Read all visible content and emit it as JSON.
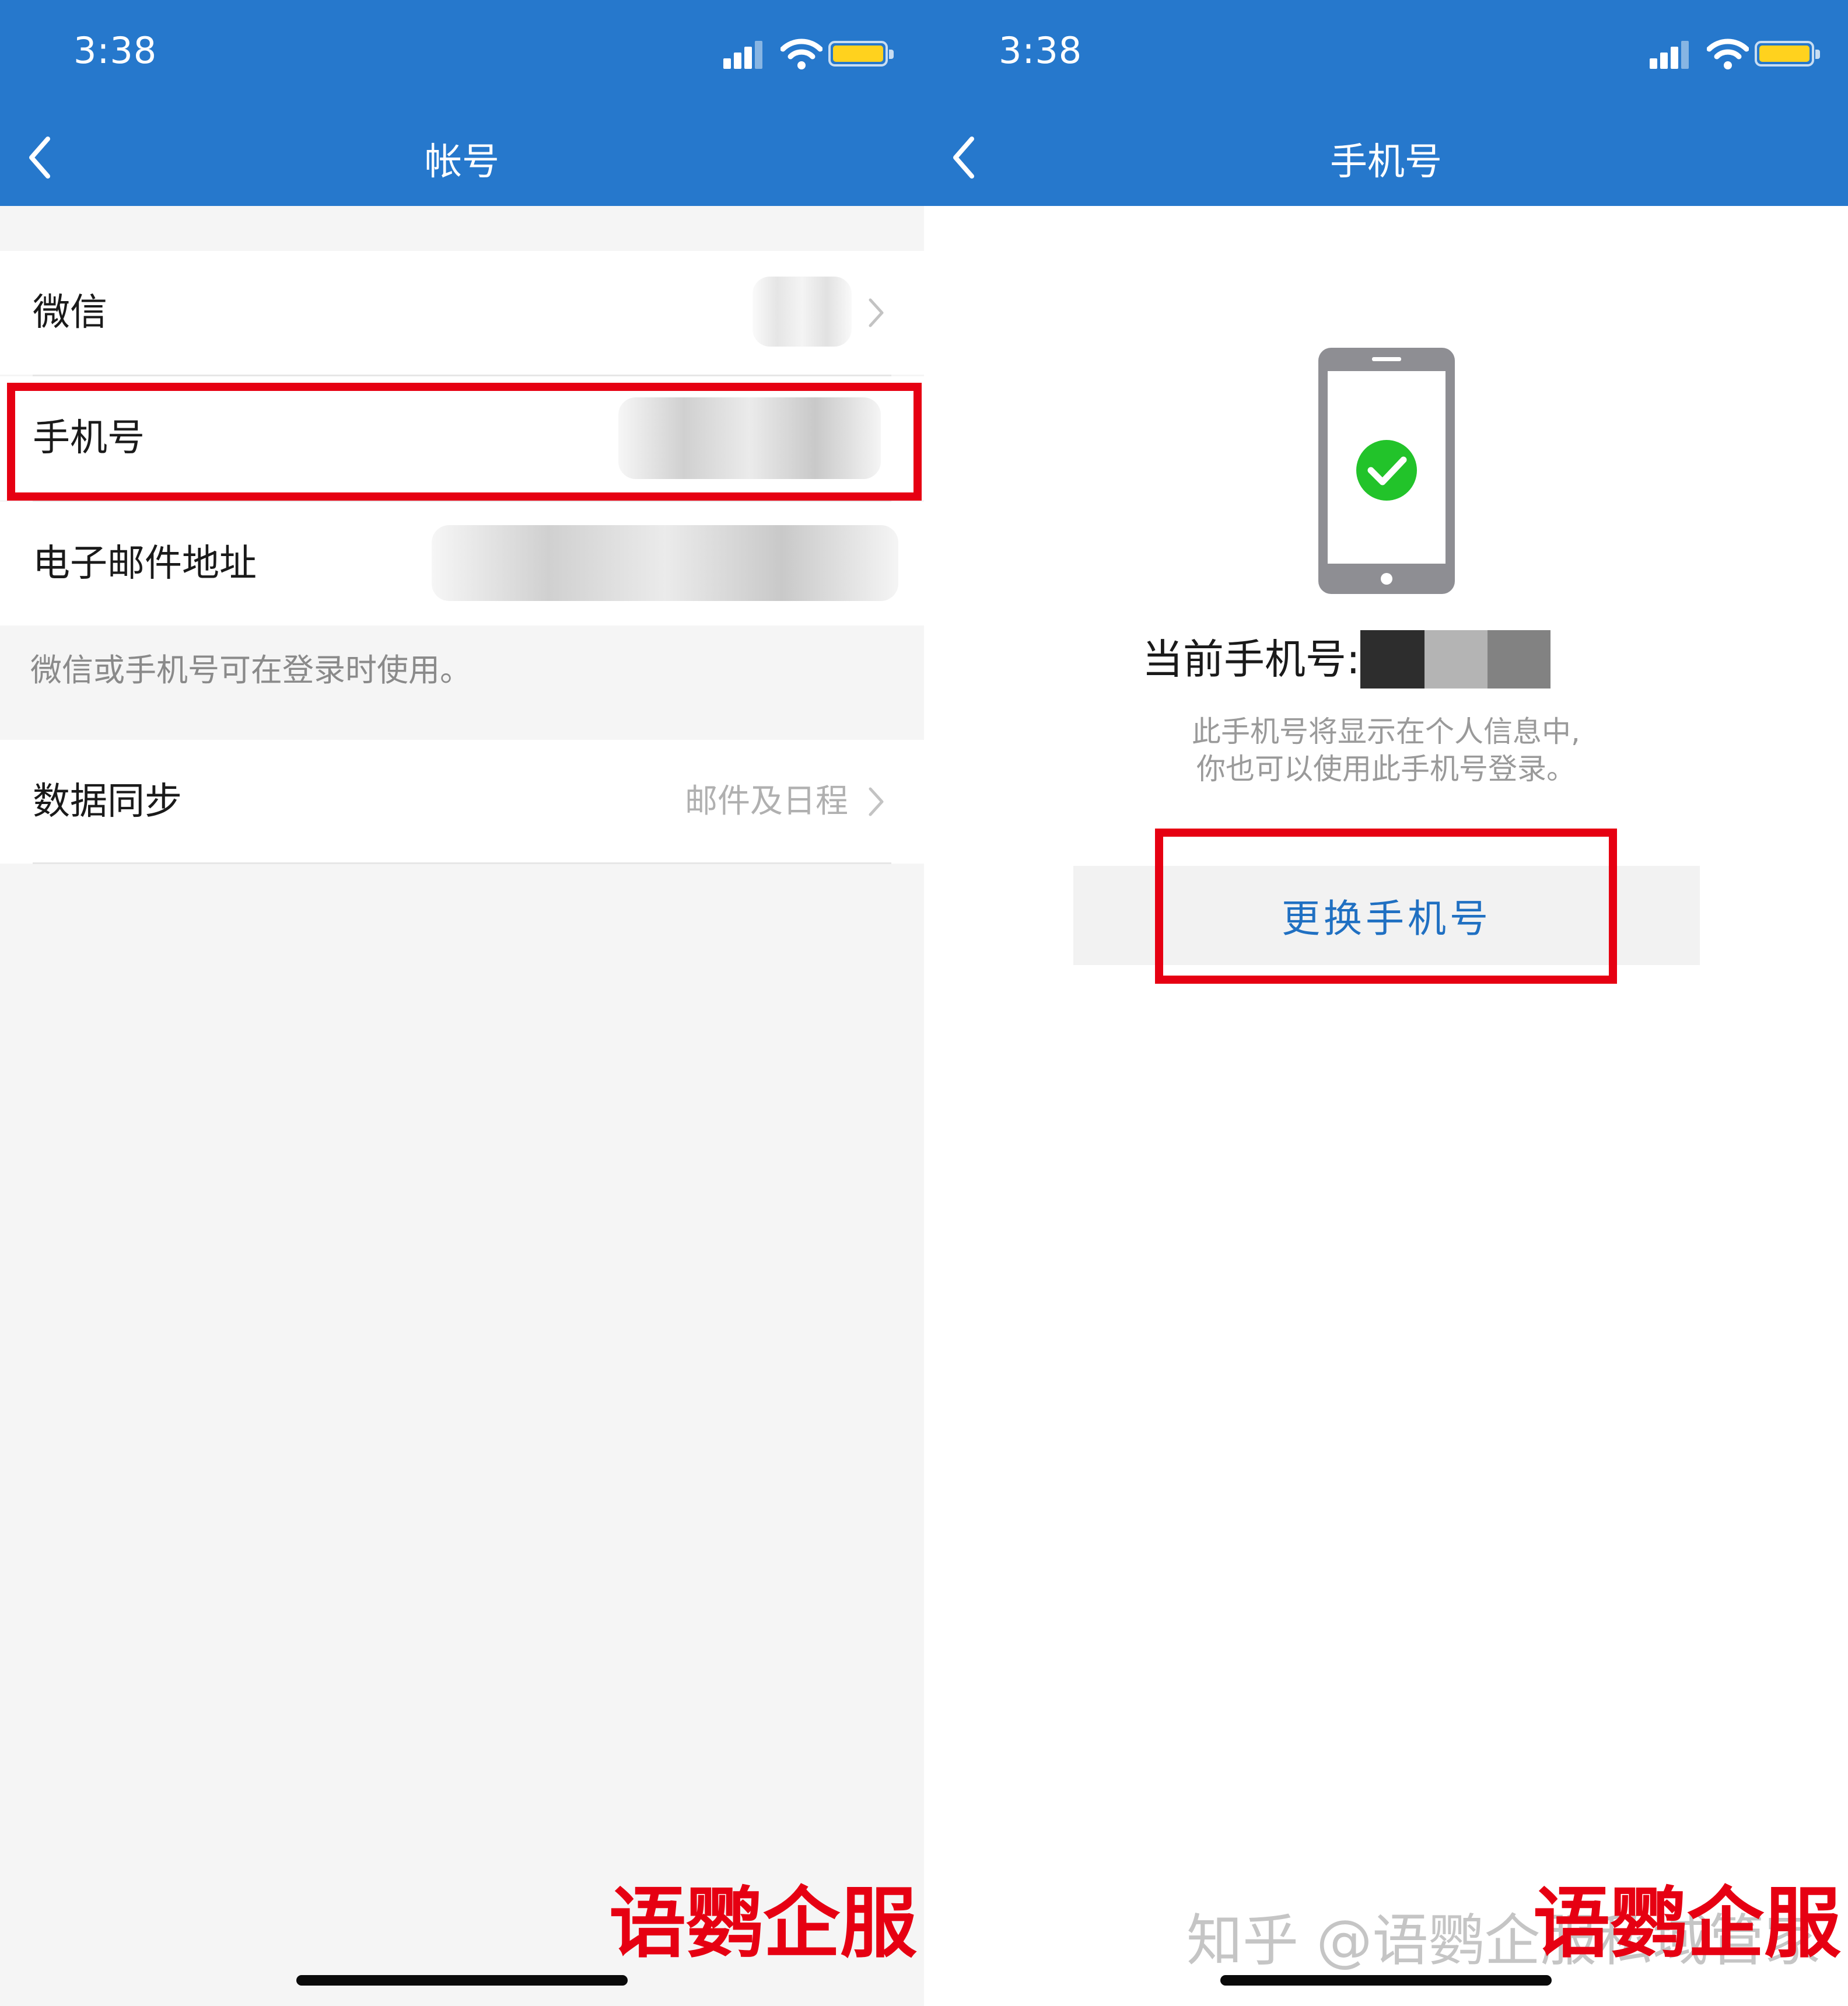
{
  "status_bar": {
    "time": "3:38"
  },
  "left": {
    "nav": {
      "title": "帐号"
    },
    "rows": [
      {
        "label": "微信"
      },
      {
        "label": "手机号"
      },
      {
        "label": "电子邮件地址"
      }
    ],
    "hint": "微信或手机号可在登录时使用。",
    "sync": {
      "label": "数据同步",
      "value": "邮件及日程"
    },
    "watermark": "语鹦企服"
  },
  "right": {
    "nav": {
      "title": "手机号"
    },
    "current_label": "当前手机号:",
    "desc_line1": "此手机号将显示在个人信息中,",
    "desc_line2": "你也可以使用此手机号登录。",
    "change_button": "更换手机号",
    "watermark": "语鹦企服",
    "credit": "知乎 @语鹦企服私域管家"
  },
  "colors": {
    "header_blue": "#2678cc",
    "highlight_red": "#e60012",
    "link_blue": "#2070c2",
    "check_green": "#22c32a",
    "battery_yellow": "#ffd21e"
  },
  "icons": [
    "signal-icon",
    "wifi-icon",
    "battery-icon",
    "back-icon",
    "chevron-right-icon",
    "phone-check-icon"
  ]
}
